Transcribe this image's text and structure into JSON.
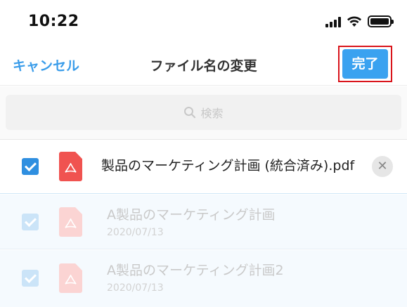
{
  "status_bar": {
    "time": "10:22",
    "icons": [
      "signal-icon",
      "wifi-icon",
      "battery-icon"
    ]
  },
  "nav": {
    "cancel_label": "キャンセル",
    "title": "ファイル名の変更",
    "done_label": "完了"
  },
  "search": {
    "placeholder": "検索",
    "icon": "search-icon"
  },
  "editing_file": {
    "filename": "製品のマーケティング計画 (統合済み).pdf",
    "checked": true,
    "icon": "pdf-file-icon"
  },
  "files": [
    {
      "title": "A製品のマーケティング計画",
      "date": "2020/07/13",
      "checked": true,
      "icon": "pdf-file-icon"
    },
    {
      "title": "A製品のマーケティング計画2",
      "date": "2020/07/13",
      "checked": true,
      "icon": "pdf-file-icon"
    }
  ],
  "colors": {
    "accent": "#3aa2f0",
    "highlight": "#d9141b",
    "pdf": "#f05350"
  }
}
